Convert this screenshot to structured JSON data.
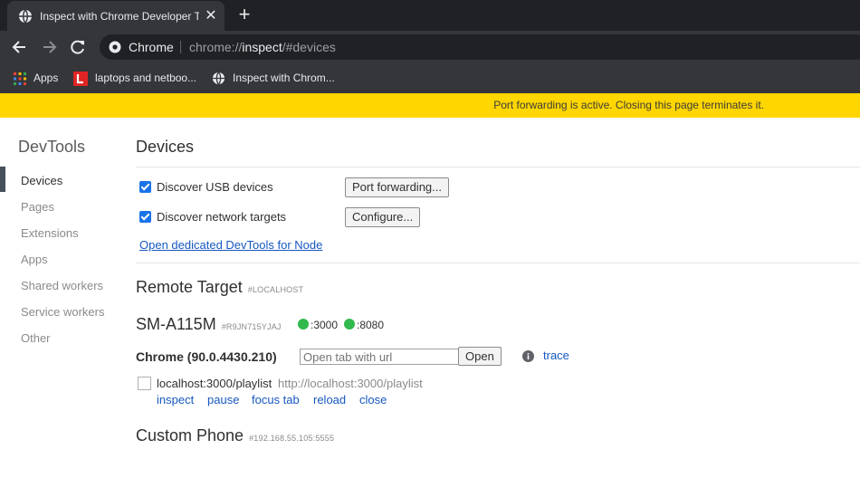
{
  "browser": {
    "tab_title": "Inspect with Chrome Developer Tools",
    "omnibox": {
      "site_label": "Chrome",
      "url_prefix": "chrome://",
      "url_host": "inspect",
      "url_suffix": "/#devices"
    },
    "bookmarks": [
      {
        "label": "Apps",
        "icon": "apps-grid-icon"
      },
      {
        "label": "laptops and netboo...",
        "icon": "l-logo-icon"
      },
      {
        "label": "Inspect with Chrom...",
        "icon": "globe-icon"
      }
    ]
  },
  "infobar": {
    "text": "Port forwarding is active. Closing this page terminates it."
  },
  "sidebar": {
    "title": "DevTools",
    "items": [
      {
        "label": "Devices",
        "selected": true
      },
      {
        "label": "Pages"
      },
      {
        "label": "Extensions"
      },
      {
        "label": "Apps"
      },
      {
        "label": "Shared workers"
      },
      {
        "label": "Service workers"
      },
      {
        "label": "Other"
      }
    ]
  },
  "devices": {
    "title": "Devices",
    "discover_usb": {
      "label": "Discover USB devices",
      "checked": true
    },
    "port_forwarding_button": "Port forwarding...",
    "discover_network": {
      "label": "Discover network targets",
      "checked": true
    },
    "configure_button": "Configure...",
    "node_link": "Open dedicated DevTools for Node"
  },
  "remote_target": {
    "title": "Remote Target",
    "subtitle": "#LOCALHOST",
    "device": {
      "name": "SM-A115M",
      "serial": "#R9JN715YJAJ",
      "ports": [
        ":3000",
        ":8080"
      ]
    },
    "browser": {
      "name": "Chrome (90.0.4430.210)",
      "open_tab_placeholder": "Open tab with url",
      "open_button": "Open",
      "trace_link": "trace"
    },
    "target": {
      "name": "localhost:3000/playlist",
      "url": "http://localhost:3000/playlist",
      "actions": [
        "inspect",
        "pause",
        "focus tab",
        "reload",
        "close"
      ]
    }
  },
  "custom_phone": {
    "title": "Custom Phone",
    "subtitle": "#192.168.55.105:5555"
  },
  "colors": {
    "infobar": "#ffd600",
    "port_dot": "#31b94d",
    "link": "#1558c0",
    "checkbox": "#1a73e8"
  }
}
